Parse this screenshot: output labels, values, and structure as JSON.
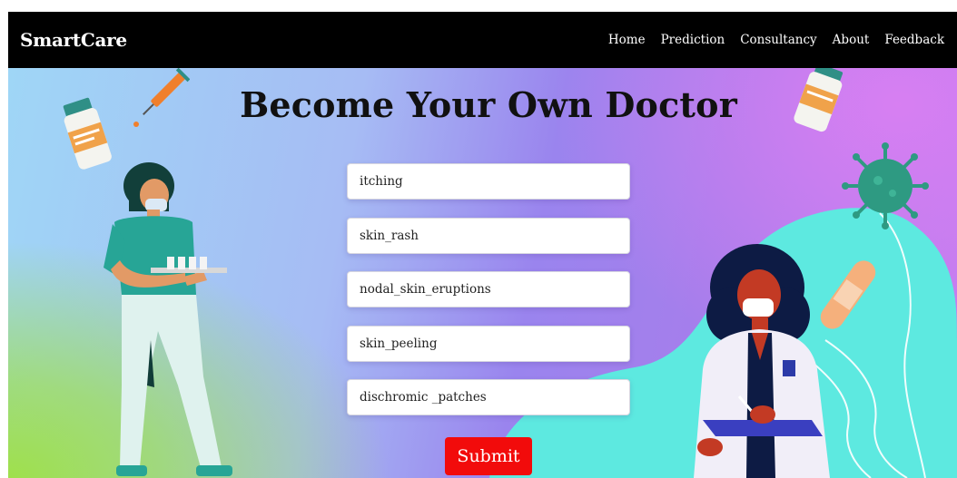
{
  "navbar": {
    "brand": "SmartCare",
    "links": [
      "Home",
      "Prediction",
      "Consultancy",
      "About",
      "Feedback"
    ]
  },
  "hero": {
    "title": "Become Your Own Doctor"
  },
  "form": {
    "symptoms": [
      "itching",
      "skin_rash",
      "nodal_skin_eruptions",
      "skin_peeling",
      "dischromic _patches"
    ],
    "submit_label": "Submit"
  },
  "colors": {
    "navbar_bg": "#000000",
    "submit_bg": "#f20b0b",
    "teal_blob": "#5de9e0"
  },
  "icons": [
    "pill-bottle-icon",
    "syringe-icon",
    "virus-icon",
    "bandage-icon",
    "nurse-illustration",
    "doctor-illustration"
  ]
}
